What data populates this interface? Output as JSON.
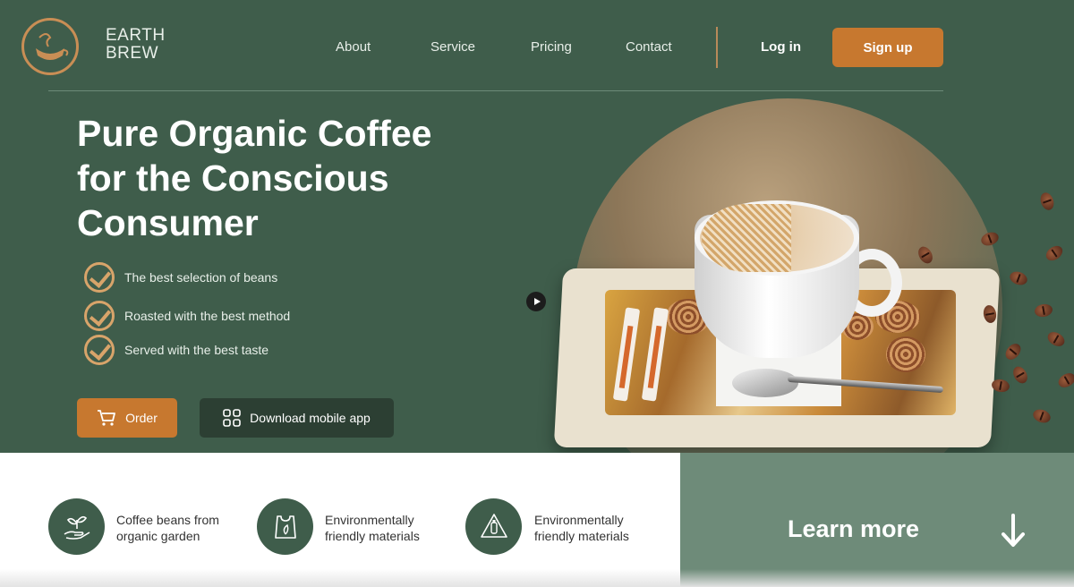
{
  "brand": {
    "line1": "EARTH",
    "line2": "BREW"
  },
  "nav": {
    "items": [
      "About",
      "Service",
      "Pricing",
      "Contact"
    ],
    "login": "Log in",
    "signup": "Sign up"
  },
  "hero": {
    "headline": "Pure Organic Coffee for the Conscious Consumer",
    "features": [
      "The best selection of beans",
      "Roasted with the best method",
      "Served with the best taste"
    ],
    "order_label": "Order",
    "app_label": "Download mobile app"
  },
  "benefits": [
    {
      "icon": "hand-sprout-icon",
      "line1": "Coffee beans from",
      "line2": "organic garden"
    },
    {
      "icon": "eco-bag-icon",
      "line1": "Environmentally",
      "line2": "friendly materials"
    },
    {
      "icon": "recycle-bottle-icon",
      "line1": "Environmentally",
      "line2": "friendly materials"
    }
  ],
  "learn_more": "Learn more",
  "colors": {
    "dark_green": "#3f5d4b",
    "accent_orange": "#c7782f",
    "light_green": "#6e8b79"
  }
}
